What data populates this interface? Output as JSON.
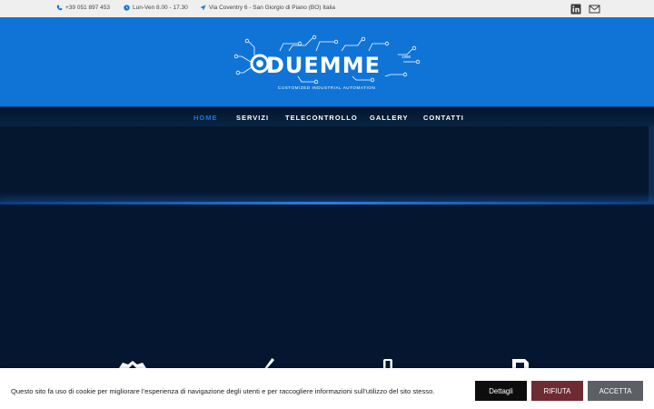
{
  "topbar": {
    "phone": "+39 051 897 453",
    "hours": "Lun-Ven 8.00 - 17.30",
    "address": "Via Coventry 6 - San Giorgio di Piano (BO) Italia",
    "icons": [
      "phone-icon",
      "clock-icon",
      "location-arrow-icon",
      "linkedin-icon",
      "envelope-icon"
    ]
  },
  "logo": {
    "word": "DUEMME",
    "year": "1996",
    "tagline": "CUSTOMIZED INDUSTRIAL AUTOMATION"
  },
  "nav": {
    "items": [
      {
        "label": "HOME",
        "active": true
      },
      {
        "label": "SERVIZI",
        "active": false
      },
      {
        "label": "TELECONTROLLO",
        "active": false
      },
      {
        "label": "GALLERY",
        "active": false
      },
      {
        "label": "CONTATTI",
        "active": false
      }
    ]
  },
  "cookie": {
    "text": "Questo sito fa uso di cookie per migliorare l’esperienza di navigazione degli utenti e per raccogliere informazioni sull’utilizzo del sito stesso.",
    "details_label": "Dettagli",
    "reject_label": "RIFIUTA",
    "accept_label": "ACCETTA"
  },
  "colors": {
    "header_blue": "#1074d7",
    "nav_active": "#1e78d6",
    "background": "#041428",
    "reject_button": "#6e2b32",
    "accept_button": "#5c5f63"
  }
}
